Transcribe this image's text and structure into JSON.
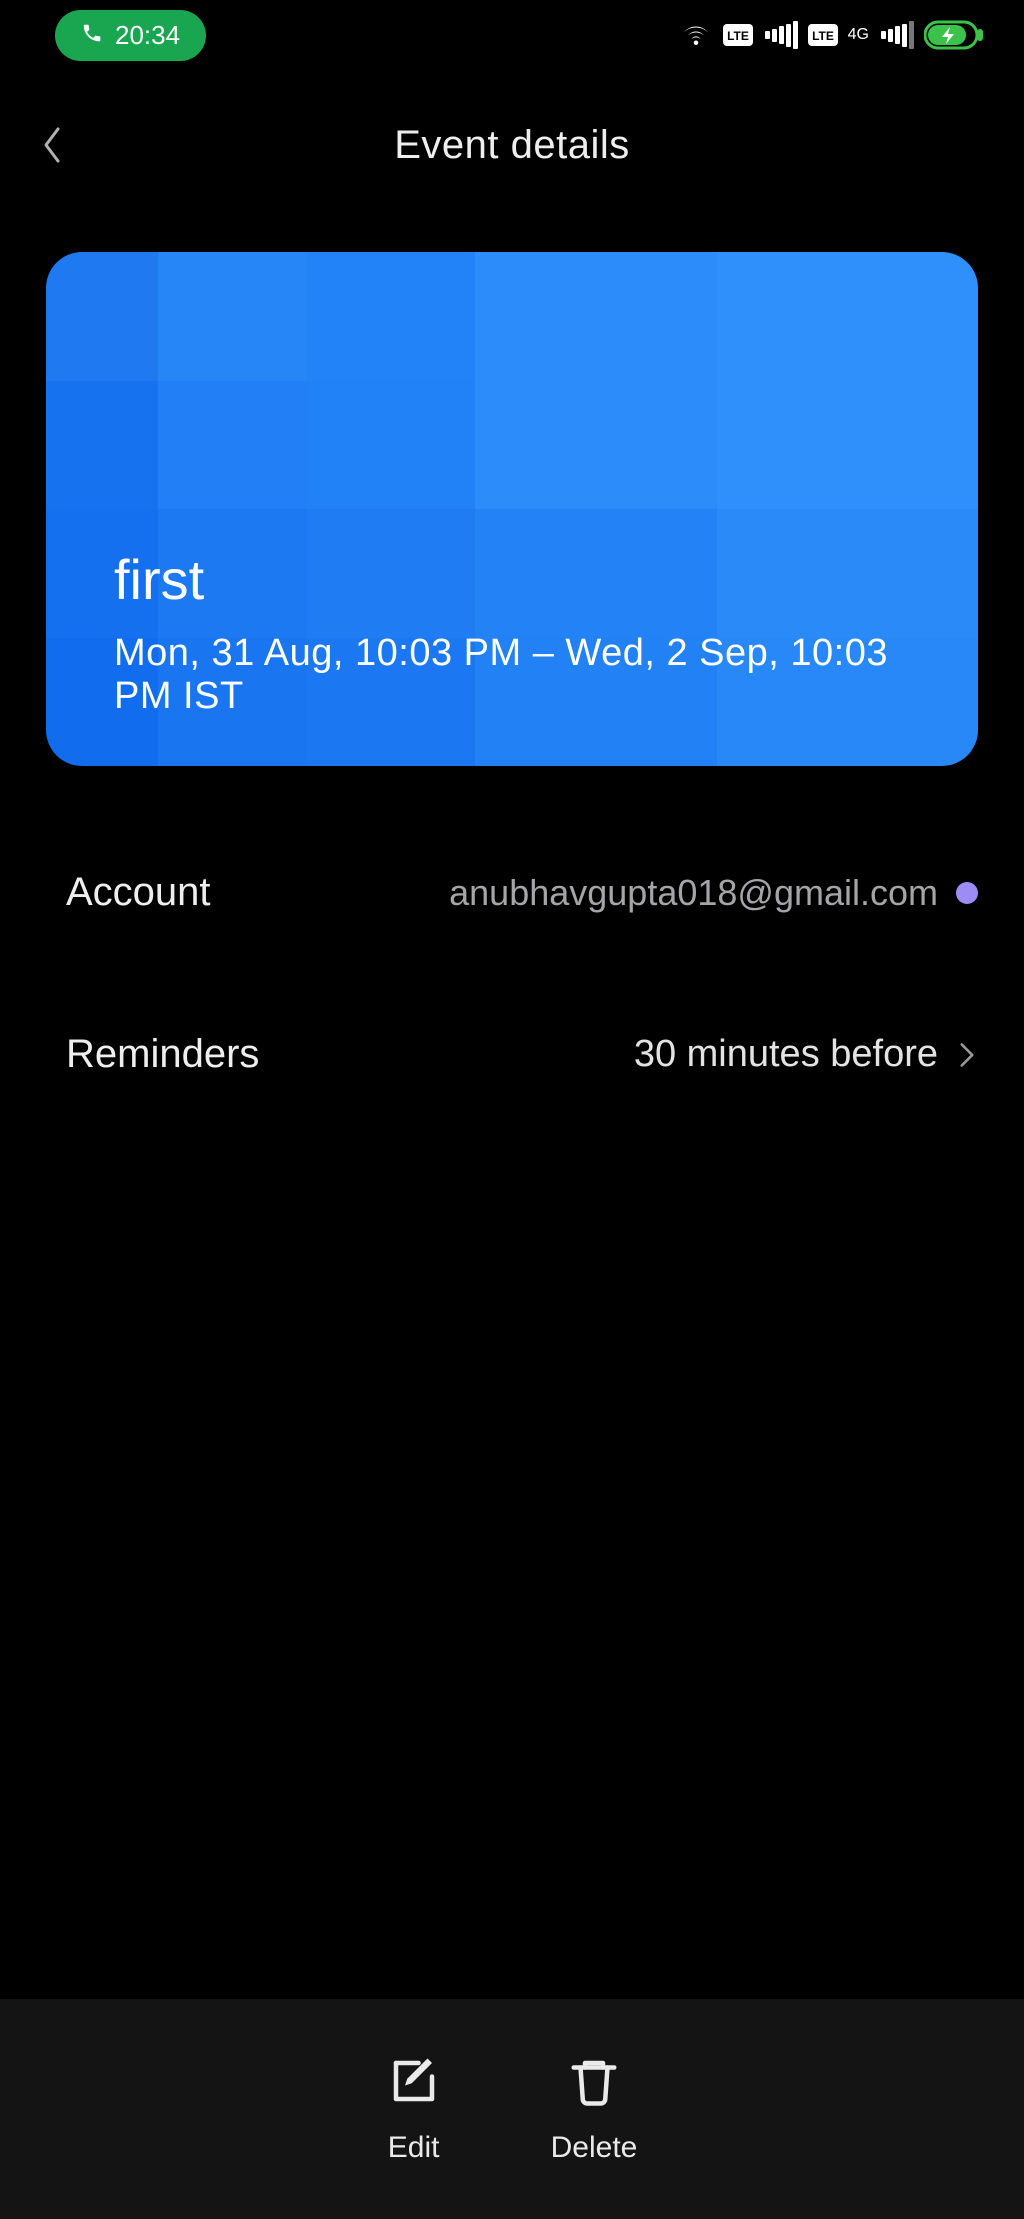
{
  "status_bar": {
    "time": "20:34",
    "network_label": "4G"
  },
  "header": {
    "title": "Event details"
  },
  "event": {
    "title": "first",
    "time_range": "Mon, 31 Aug, 10:03 PM – Wed, 2 Sep, 10:03 PM  IST"
  },
  "account": {
    "label": "Account",
    "email": "anubhavgupta018@gmail.com",
    "dot_color": "#9d8cf5"
  },
  "reminders": {
    "label": "Reminders",
    "value": "30 minutes before"
  },
  "bottom_bar": {
    "edit_label": "Edit",
    "delete_label": "Delete"
  }
}
